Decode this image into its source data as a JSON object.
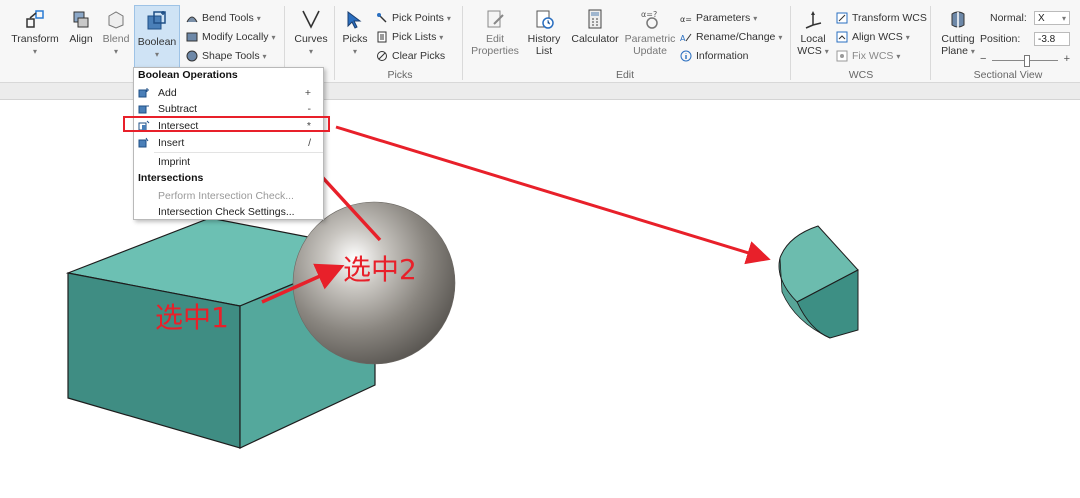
{
  "ribbon": {
    "transform": "Transform",
    "align": "Align",
    "blend": "Blend",
    "boolean": "Boolean",
    "bend_tools": "Bend Tools",
    "modify_locally": "Modify Locally",
    "shape_tools": "Shape Tools",
    "curves": "Curves",
    "picks": "Picks",
    "pick_points": "Pick Points",
    "pick_lists": "Pick Lists",
    "clear_picks": "Clear Picks",
    "picks_group": "Picks",
    "edit_properties_1": "Edit",
    "edit_properties_2": "Properties",
    "history_1": "History",
    "history_2": "List",
    "calculator": "Calculator",
    "parametric_1": "Parametric",
    "parametric_2": "Update",
    "parameters": "Parameters",
    "rename_change": "Rename/Change",
    "information": "Information",
    "edit_group": "Edit",
    "local_wcs_1": "Local",
    "local_wcs_2": "WCS",
    "transform_wcs": "Transform WCS",
    "align_wcs": "Align WCS",
    "fix_wcs": "Fix WCS",
    "wcs_group": "WCS",
    "cutting_plane_1": "Cutting",
    "cutting_plane_2": "Plane",
    "normal_label": "Normal:",
    "normal_value": "X",
    "position_label": "Position:",
    "position_value": "-3.8",
    "sectional_group": "Sectional View"
  },
  "menu": {
    "boolean_header": "Boolean Operations",
    "add": "Add",
    "add_sc": "+",
    "subtract": "Subtract",
    "subtract_sc": "-",
    "intersect": "Intersect",
    "intersect_sc": "*",
    "insert": "Insert",
    "insert_sc": "/",
    "imprint": "Imprint",
    "intersections_header": "Intersections",
    "perform_check": "Perform Intersection Check...",
    "check_settings": "Intersection Check Settings..."
  },
  "annotations": {
    "select1": "选中1",
    "select2": "选中2"
  },
  "colors": {
    "accent_red": "#e8202a",
    "teal_solid": "#5fb6a8"
  }
}
